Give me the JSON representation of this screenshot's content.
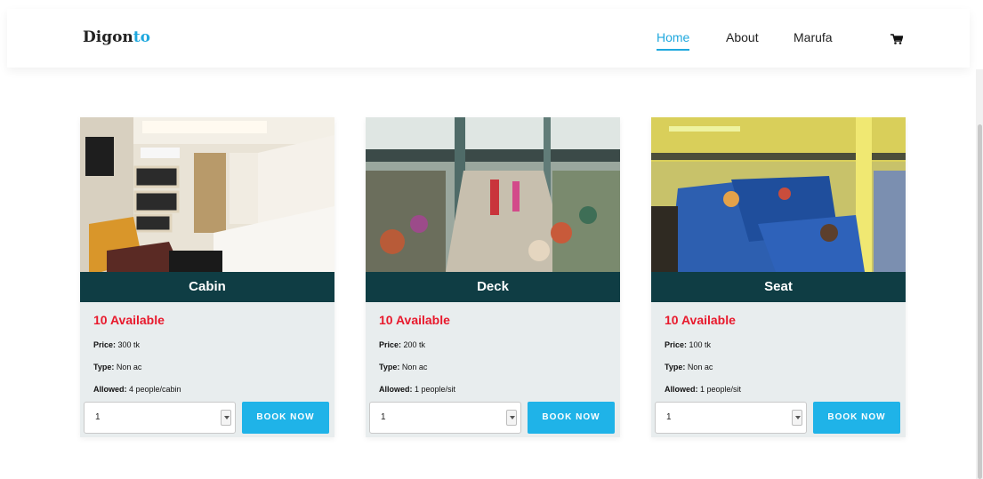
{
  "brand": {
    "part1": "Digon",
    "part2": "to"
  },
  "nav": {
    "home": "Home",
    "about": "About",
    "user": "Marufa"
  },
  "colors": {
    "accent": "#1fa8de",
    "title_bar": "#0f3d44",
    "available": "#e8192c",
    "button": "#1fb3e8"
  },
  "cards": [
    {
      "title": "Cabin",
      "available": "10 Available",
      "price_label": "Price:",
      "price": " 300 tk",
      "type_label": "Type:",
      "type": " Non ac",
      "allowed_label": "Allowed:",
      "allowed": " 4 people/cabin",
      "qty": "1",
      "button": "BOOK NOW"
    },
    {
      "title": "Deck",
      "available": "10 Available",
      "price_label": "Price:",
      "price": " 200 tk",
      "type_label": "Type:",
      "type": " Non ac",
      "allowed_label": "Allowed:",
      "allowed": " 1 people/sit",
      "qty": "1",
      "button": "BOOK NOW"
    },
    {
      "title": "Seat",
      "available": "10 Available",
      "price_label": "Price:",
      "price": " 100 tk",
      "type_label": "Type:",
      "type": " Non ac",
      "allowed_label": "Allowed:",
      "allowed": " 1 people/sit",
      "qty": "1",
      "button": "BOOK NOW"
    }
  ]
}
